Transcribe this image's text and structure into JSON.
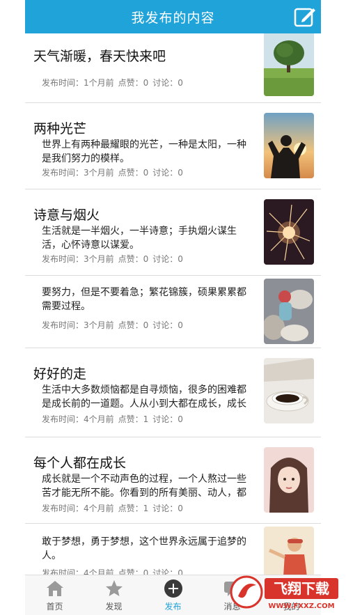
{
  "header": {
    "title": "我发布的内容"
  },
  "posts": [
    {
      "title": "天气渐暖，春天快来吧",
      "excerpt": "",
      "time": "发布时间：1个月前",
      "likes": "点赞：0",
      "comments": "讨论：0",
      "thumb": "tree-photo"
    },
    {
      "title": "两种光芒",
      "excerpt": "世界上有两种最耀眼的光芒，一种是太阳，一种是我们努力的模样。",
      "time": "发布时间：3个月前",
      "likes": "点赞：0",
      "comments": "讨论：0",
      "thumb": "sunset-person-photo"
    },
    {
      "title": "诗意与烟火",
      "excerpt": "生活就是一半烟火，一半诗意；手执烟火谋生活，心怀诗意以谋爱。",
      "time": "发布时间：3个月前",
      "likes": "点赞：0",
      "comments": "讨论：0",
      "thumb": "sparkler-photo"
    },
    {
      "title": "",
      "excerpt": "要努力，但是不要着急；繁花锦簇，硕果累累都需要过程。",
      "time": "发布时间：3个月前",
      "likes": "点赞：0",
      "comments": "讨论：0",
      "thumb": "toy-figure-photo"
    },
    {
      "title": "好好的走",
      "excerpt": "生活中大多数烦恼都是自寻烦恼，很多的困难都是成长前的一道题。人从小到大都在成长，成长",
      "time": "发布时间：4个月前",
      "likes": "点赞：1",
      "comments": "讨论：0",
      "thumb": "coffee-cup-photo"
    },
    {
      "title": "每个人都在成长",
      "excerpt": "成长就是一个不动声色的过程，一个人熬过一些苦才能无所不能。你看到的所有美丽、动人，都",
      "time": "发布时间：4个月前",
      "likes": "点赞：1",
      "comments": "讨论：0",
      "thumb": "girl-portrait-photo"
    },
    {
      "title": "",
      "excerpt": "敢于梦想，勇于梦想，这个世界永远属于追梦的人。",
      "time": "发布时间：4个月前",
      "likes": "点赞：0",
      "comments": "讨论：0",
      "thumb": "child-beach-photo"
    }
  ],
  "tabbar": {
    "tabs": [
      {
        "label": "首页",
        "icon": "home-icon"
      },
      {
        "label": "发现",
        "icon": "discover-star-icon"
      },
      {
        "label": "发布",
        "icon": "publish-plus-icon"
      },
      {
        "label": "消息",
        "icon": "message-icon"
      },
      {
        "label": "我的",
        "icon": "profile-icon"
      }
    ],
    "active": 2
  },
  "watermark": {
    "text": "飞翔下载",
    "url_text": "WWW.FXXZ.COM"
  },
  "colors": {
    "accent": "#1fa3d8",
    "watermark_red": "#d9342b"
  }
}
